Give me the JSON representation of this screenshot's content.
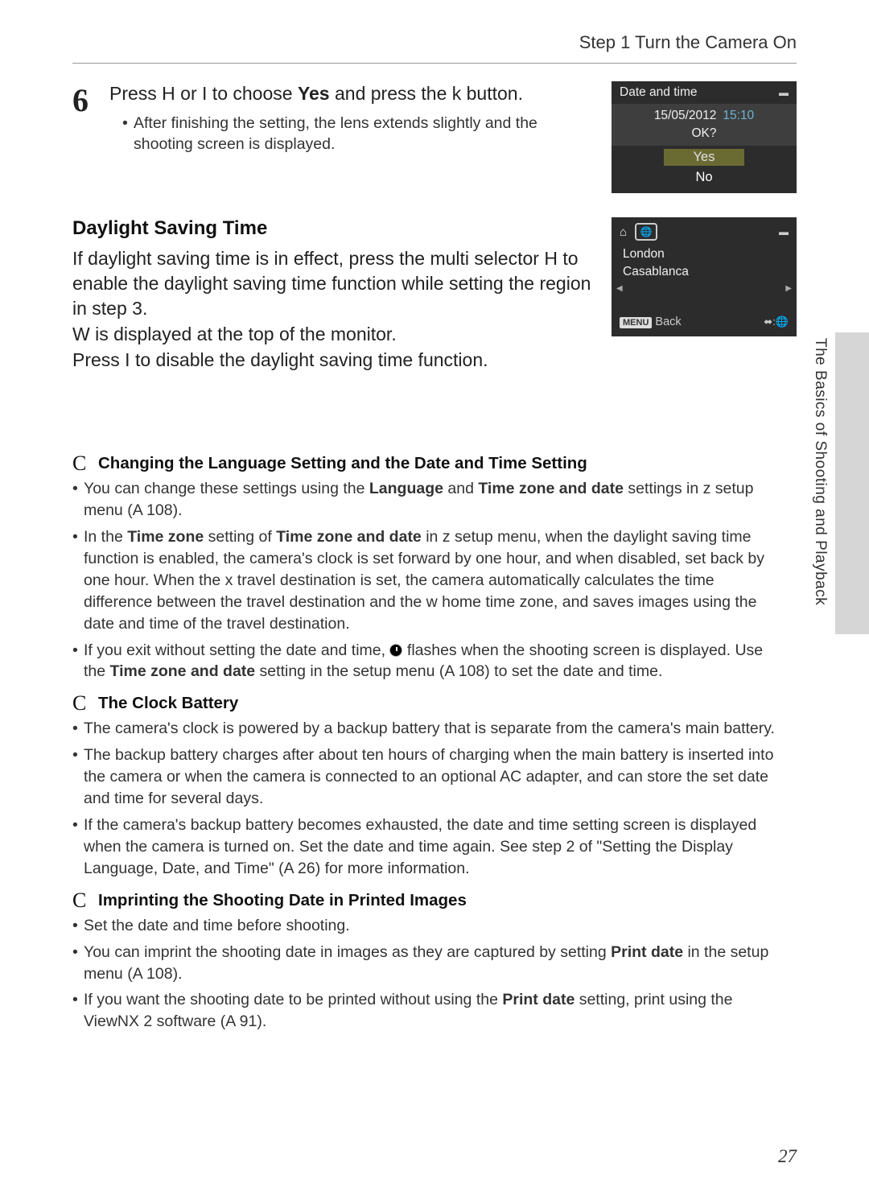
{
  "header": {
    "title": "Step 1 Turn the Camera On"
  },
  "step6": {
    "num": "6",
    "lineA": "Press H or I to choose ",
    "bold": "Yes",
    "lineB": " and press the k button.",
    "bullet": "After finishing the setting, the lens extends slightly and the shooting screen is displayed."
  },
  "screen1": {
    "title": "Date and time",
    "date": "15/05/2012",
    "time": "15:10",
    "ok": "OK?",
    "yes": "Yes",
    "no": "No"
  },
  "dst": {
    "heading": "Daylight Saving Time",
    "p1": "If daylight saving time is in effect, press the multi selector H to enable the daylight saving time function while setting the region in step 3.",
    "p2": "W is displayed at the top of the monitor.",
    "p3": "Press I to disable the daylight saving time function."
  },
  "screen2": {
    "city1": "London",
    "city2": "Casablanca",
    "menu": "MENU",
    "back": "Back"
  },
  "side": {
    "label": "The Basics of Shooting and Playback"
  },
  "noteA": {
    "icon": "C",
    "title": "Changing the Language Setting and the Date and Time Setting",
    "b1_pre": "You can change these settings using the ",
    "b1_s1": "Language",
    "b1_mid": " and ",
    "b1_s2": "Time zone and date",
    "b1_post": " settings in z setup menu (A 108).",
    "b2_pre": "In the ",
    "b2_s1": "Time zone",
    "b2_mid1": " setting of ",
    "b2_s2": "Time zone and date",
    "b2_post": " in z setup menu, when the daylight saving time function is enabled, the camera's clock is set forward by one hour, and when disabled, set back by one hour. When the x travel destination is set, the camera automatically calculates the time difference between the travel destination and the w home time zone, and saves images using the date and time of the travel destination.",
    "b3_pre": "If you exit without setting the date and time, ",
    "b3_mid": " flashes when the shooting screen is displayed. Use the ",
    "b3_s1": "Time zone and date",
    "b3_post": " setting in the setup menu (A 108) to set the date and time."
  },
  "noteB": {
    "icon": "C",
    "title": "The Clock Battery",
    "b1": "The camera's clock is powered by a backup battery that is separate from the camera's main battery.",
    "b2": "The backup battery charges after about ten hours of charging when the main battery is inserted into the camera or when the camera is connected to an optional AC adapter, and can store the set date and time for several days.",
    "b3": "If the camera's backup battery becomes exhausted, the date and time setting screen is displayed when the camera is turned on. Set the date and time again. See step 2 of \"Setting the Display Language, Date, and Time\" (A 26) for more information."
  },
  "noteC": {
    "icon": "C",
    "title": "Imprinting the Shooting Date in Printed Images",
    "b1": "Set the date and time before shooting.",
    "b2_pre": "You can imprint the shooting date in images as they are captured by setting ",
    "b2_s1": "Print date",
    "b2_post": " in the setup menu (A 108).",
    "b3_pre": "If you want the shooting date to be printed without using the ",
    "b3_s1": "Print date",
    "b3_post": " setting, print using the ViewNX 2 software (A 91)."
  },
  "page_num": "27"
}
